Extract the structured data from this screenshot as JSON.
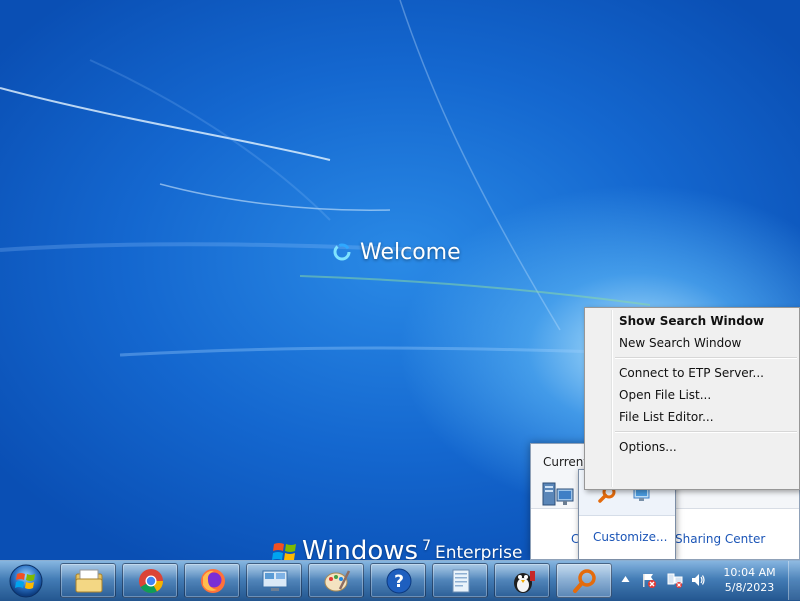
{
  "desktop": {
    "welcome_text": "Welcome",
    "brand_name": "Windows",
    "brand_version": "7",
    "brand_edition": "Enterprise"
  },
  "tray_panel": {
    "title": "Current",
    "link_left": "C",
    "link_sharing": "Sharing Center"
  },
  "overflow": {
    "customize_label": "Customize..."
  },
  "context_menu": {
    "items": [
      {
        "label": "Show Search Window",
        "bold": true
      },
      {
        "label": "New Search Window"
      },
      {
        "label": "Connect to ETP Server..."
      },
      {
        "label": "Open File List..."
      },
      {
        "label": "File List Editor..."
      },
      {
        "label": "Options..."
      }
    ]
  },
  "taskbar": {
    "pinned": [
      "explorer-icon",
      "chrome-icon",
      "firefox-icon",
      "remote-desktop-icon",
      "paint-icon",
      "help-icon",
      "notepad-icon",
      "penguin-app-icon",
      "search-everything-icon"
    ]
  },
  "clock": {
    "time": "10:04 AM",
    "date": "5/8/2023"
  },
  "colors": {
    "accent": "#1b55b7",
    "desktop": "#1467cf"
  }
}
